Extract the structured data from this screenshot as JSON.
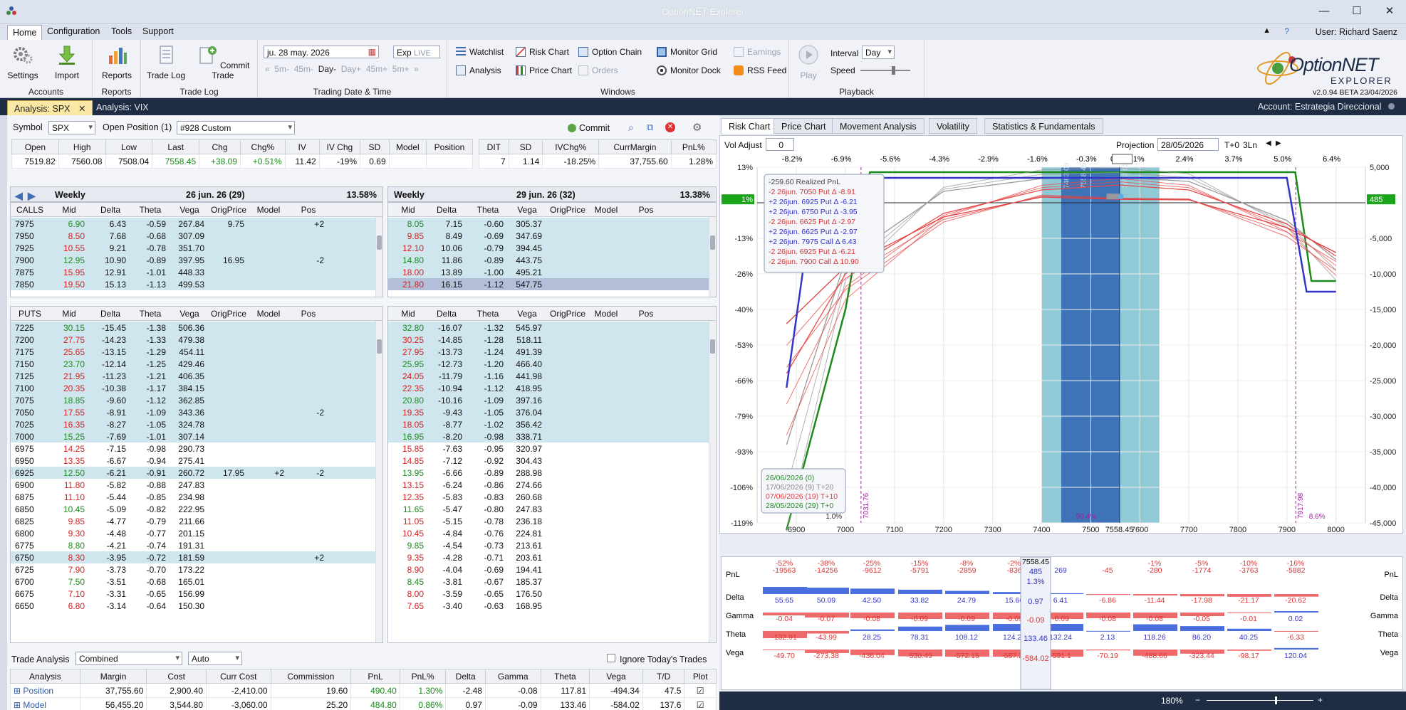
{
  "window": {
    "title": "OptionNET Explorer",
    "min": "—",
    "max": "☐",
    "close": "✕"
  },
  "menu": {
    "home": "Home",
    "configuration": "Configuration",
    "tools": "Tools",
    "support": "Support",
    "user": "User: Richard Saenz"
  },
  "ribbon": {
    "settings": "Settings",
    "import": "Import",
    "accounts": "Accounts",
    "reports_btn": "Reports",
    "reports": "Reports",
    "trade_log_btn": "Trade Log",
    "commit_trade": "Commit Trade",
    "trade_log": "Trade Log",
    "date": "ju. 28 may. 2026",
    "exp": "Exp",
    "live": "LIVE",
    "nav": [
      "5m-",
      "45m-",
      "Day-",
      "Day+",
      "45m+",
      "5m+"
    ],
    "trading_date": "Trading Date & Time",
    "watchlist": "Watchlist",
    "analysis": "Analysis",
    "risk_chart": "Risk Chart",
    "price_chart": "Price Chart",
    "option_chain": "Option Chain",
    "orders": "Orders",
    "monitor_grid": "Monitor Grid",
    "monitor_dock": "Monitor Dock",
    "earnings": "Earnings",
    "rss_feed": "RSS Feed",
    "windows": "Windows",
    "play": "Play",
    "interval": "Interval",
    "interval_val": "Day",
    "speed": "Speed",
    "playback": "Playback",
    "brand1": "OptionNET",
    "brand2": "EXPLORER",
    "version": "v2.0.94 BETA 23/04/2026"
  },
  "tabs": {
    "spx": "Analysis: SPX",
    "vix": "Analysis: VIX",
    "account": "Account: Estrategia Direccional"
  },
  "symbol": {
    "label": "Symbol",
    "value": "SPX",
    "open_label": "Open Position (1)",
    "position": "#928 Custom",
    "commit": "Commit"
  },
  "quote": {
    "headers": [
      "Open",
      "High",
      "Low",
      "Last",
      "Chg",
      "Chg%",
      "IV",
      "IV Chg",
      "SD",
      "Model",
      "Position"
    ],
    "values": [
      "7519.82",
      "7560.08",
      "7508.04",
      "7558.45",
      "+38.09",
      "+0.51%",
      "11.42",
      "-19%",
      "0.69",
      "",
      ""
    ],
    "headers2": [
      "DIT",
      "SD",
      "IVChg%",
      "CurrMargin",
      "PnL%"
    ],
    "values2": [
      "7",
      "1.14",
      "-18.25%",
      "37,755.60",
      "1.28%"
    ]
  },
  "chains": {
    "left_title": "Weekly",
    "left_exp": "26 jun. 26 (29)",
    "left_iv": "13.58%",
    "right_title": "Weekly",
    "right_exp": "29 jun. 26 (32)",
    "right_iv": "13.38%",
    "calls": "CALLS",
    "puts": "PUTS",
    "cols": [
      "Mid",
      "Delta",
      "Theta",
      "Vega",
      "OrigPrice",
      "Model",
      "Pos"
    ],
    "call_rows": [
      [
        "7975",
        "6.90",
        "6.43",
        "-0.59",
        "267.84",
        "9.75",
        "",
        "+2",
        "8.05",
        "7.15",
        "-0.60",
        "305.37"
      ],
      [
        "7950",
        "8.50",
        "7.68",
        "-0.68",
        "307.09",
        "",
        "",
        "",
        "9.85",
        "8.49",
        "-0.69",
        "347.69"
      ],
      [
        "7925",
        "10.55",
        "9.21",
        "-0.78",
        "351.70",
        "",
        "",
        "",
        "12.10",
        "10.06",
        "-0.79",
        "394.45"
      ],
      [
        "7900",
        "12.95",
        "10.90",
        "-0.89",
        "397.95",
        "16.95",
        "",
        "-2",
        "14.80",
        "11.86",
        "-0.89",
        "443.75"
      ],
      [
        "7875",
        "15.95",
        "12.91",
        "-1.01",
        "448.33",
        "",
        "",
        "",
        "18.00",
        "13.89",
        "-1.00",
        "495.21"
      ],
      [
        "7850",
        "19.50",
        "15.13",
        "-1.13",
        "499.53",
        "",
        "",
        "",
        "21.80",
        "16.15",
        "-1.12",
        "547.75"
      ]
    ],
    "put_rows": [
      [
        "7225",
        "30.15",
        "-15.45",
        "-1.38",
        "506.36",
        "",
        "",
        "",
        "32.80",
        "-16.07",
        "-1.32",
        "545.97"
      ],
      [
        "7200",
        "27.75",
        "-14.23",
        "-1.33",
        "479.38",
        "",
        "",
        "",
        "30.25",
        "-14.85",
        "-1.28",
        "518.11"
      ],
      [
        "7175",
        "25.65",
        "-13.15",
        "-1.29",
        "454.11",
        "",
        "",
        "",
        "27.95",
        "-13.73",
        "-1.24",
        "491.39"
      ],
      [
        "7150",
        "23.70",
        "-12.14",
        "-1.25",
        "429.46",
        "",
        "",
        "",
        "25.95",
        "-12.73",
        "-1.20",
        "466.40"
      ],
      [
        "7125",
        "21.95",
        "-11.23",
        "-1.21",
        "406.35",
        "",
        "",
        "",
        "24.05",
        "-11.79",
        "-1.16",
        "441.98"
      ],
      [
        "7100",
        "20.35",
        "-10.38",
        "-1.17",
        "384.15",
        "",
        "",
        "",
        "22.35",
        "-10.94",
        "-1.12",
        "418.95"
      ],
      [
        "7075",
        "18.85",
        "-9.60",
        "-1.12",
        "362.85",
        "",
        "",
        "",
        "20.80",
        "-10.16",
        "-1.09",
        "397.16"
      ],
      [
        "7050",
        "17.55",
        "-8.91",
        "-1.09",
        "343.36",
        "",
        "",
        "-2",
        "19.35",
        "-9.43",
        "-1.05",
        "376.04"
      ],
      [
        "7025",
        "16.35",
        "-8.27",
        "-1.05",
        "324.78",
        "",
        "",
        "",
        "18.05",
        "-8.77",
        "-1.02",
        "356.42"
      ],
      [
        "7000",
        "15.25",
        "-7.69",
        "-1.01",
        "307.14",
        "",
        "",
        "",
        "16.95",
        "-8.20",
        "-0.98",
        "338.71"
      ],
      [
        "6975",
        "14.25",
        "-7.15",
        "-0.98",
        "290.73",
        "",
        "",
        "",
        "15.85",
        "-7.63",
        "-0.95",
        "320.97"
      ],
      [
        "6950",
        "13.35",
        "-6.67",
        "-0.94",
        "275.41",
        "",
        "",
        "",
        "14.85",
        "-7.12",
        "-0.92",
        "304.43"
      ],
      [
        "6925",
        "12.50",
        "-6.21",
        "-0.91",
        "260.72",
        "17.95",
        "+2",
        "-2",
        "13.95",
        "-6.66",
        "-0.89",
        "288.98"
      ],
      [
        "6900",
        "11.80",
        "-5.82",
        "-0.88",
        "247.83",
        "",
        "",
        "",
        "13.15",
        "-6.24",
        "-0.86",
        "274.66"
      ],
      [
        "6875",
        "11.10",
        "-5.44",
        "-0.85",
        "234.98",
        "",
        "",
        "",
        "12.35",
        "-5.83",
        "-0.83",
        "260.68"
      ],
      [
        "6850",
        "10.45",
        "-5.09",
        "-0.82",
        "222.95",
        "",
        "",
        "",
        "11.65",
        "-5.47",
        "-0.80",
        "247.83"
      ],
      [
        "6825",
        "9.85",
        "-4.77",
        "-0.79",
        "211.66",
        "",
        "",
        "",
        "11.05",
        "-5.15",
        "-0.78",
        "236.18"
      ],
      [
        "6800",
        "9.30",
        "-4.48",
        "-0.77",
        "201.15",
        "",
        "",
        "",
        "10.45",
        "-4.84",
        "-0.76",
        "224.81"
      ],
      [
        "6775",
        "8.80",
        "-4.21",
        "-0.74",
        "191.31",
        "",
        "",
        "",
        "9.85",
        "-4.54",
        "-0.73",
        "213.61"
      ],
      [
        "6750",
        "8.30",
        "-3.95",
        "-0.72",
        "181.59",
        "",
        "",
        "+2",
        "9.35",
        "-4.28",
        "-0.71",
        "203.61"
      ],
      [
        "6725",
        "7.90",
        "-3.73",
        "-0.70",
        "173.22",
        "",
        "",
        "",
        "8.90",
        "-4.04",
        "-0.69",
        "194.41"
      ],
      [
        "6700",
        "7.50",
        "-3.51",
        "-0.68",
        "165.01",
        "",
        "",
        "",
        "8.45",
        "-3.81",
        "-0.67",
        "185.37"
      ],
      [
        "6675",
        "7.10",
        "-3.31",
        "-0.65",
        "156.99",
        "",
        "",
        "",
        "8.00",
        "-3.59",
        "-0.65",
        "176.50"
      ],
      [
        "6650",
        "6.80",
        "-3.14",
        "-0.64",
        "150.30",
        "",
        "",
        "",
        "7.65",
        "-3.40",
        "-0.63",
        "168.95"
      ]
    ]
  },
  "trade_analysis": {
    "label": "Trade Analysis",
    "mode": "Combined",
    "auto": "Auto",
    "ignore": "Ignore Today's Trades",
    "headers": [
      "Analysis",
      "Margin",
      "Cost",
      "Curr Cost",
      "Commission",
      "PnL",
      "PnL%",
      "Delta",
      "Gamma",
      "Theta",
      "Vega",
      "T/D",
      "Plot"
    ],
    "rows": [
      [
        "Position",
        "37,755.60",
        "2,900.40",
        "-2,410.00",
        "19.60",
        "490.40",
        "1.30%",
        "-2.48",
        "-0.08",
        "117.81",
        "-494.34",
        "47.5"
      ],
      [
        "Model",
        "56,455.20",
        "3,544.80",
        "-3,060.00",
        "25.20",
        "484.80",
        "0.86%",
        "0.97",
        "-0.09",
        "133.46",
        "-584.02",
        "137.6"
      ]
    ]
  },
  "right": {
    "tabs": [
      "Risk Chart",
      "Price Chart",
      "Movement Analysis",
      "Volatility",
      "Statistics & Fundamentals"
    ],
    "vol_adjust": "Vol Adjust",
    "vol_val": "0",
    "projection": "Projection",
    "proj_date": "28/05/2026",
    "proj_t": "T+0",
    "proj_ln": "3Ln",
    "zoom": "180%"
  },
  "chart_data": {
    "type": "line",
    "title": "",
    "x_ticks": [
      "6900",
      "7000",
      "7100",
      "7200",
      "7300",
      "7400",
      "7500",
      "7558.45",
      "7600",
      "7700",
      "7800",
      "7900",
      "8000"
    ],
    "top_pct": [
      "-8.2%",
      "-6.9%",
      "-5.6%",
      "-4.3%",
      "-2.9%",
      "-1.6%",
      "-0.3%",
      "0.5%",
      "1.1%",
      "2.4%",
      "3.7%",
      "5.0%",
      "6.4%"
    ],
    "y_left": [
      "13%",
      "1%",
      "-13%",
      "-26%",
      "-40%",
      "-53%",
      "-66%",
      "-79%",
      "-93%",
      "-106%",
      "-119%"
    ],
    "y_right": [
      "5,000",
      "485",
      "-5,000",
      "-10,000",
      "-15,000",
      "-20,000",
      "-25,000",
      "-30,000",
      "-35,000",
      "-40,000",
      "-45,000"
    ],
    "vlines": [
      "7031.76",
      "7917.98"
    ],
    "std_labels": [
      "1.0%",
      "90.4%",
      "8.6%"
    ],
    "legend": [
      "-259.60 Realized PnL",
      "-2 26jun. 7050 Put Δ -8.91",
      "+2 26jun. 6925 Put Δ -6.21",
      "+2 26jun. 6750 Put Δ -3.95",
      "-2 26jun. 6625 Put Δ -2.97",
      "+2 26jun. 6625 Put Δ -2.97",
      "+2 26jun. 7975 Call Δ 6.43",
      "-2 26jun. 6925 Put Δ -6.21",
      "-2 26jun. 7900 Call Δ 10.90"
    ],
    "dates": [
      "26/06/2026 (0)",
      "17/06/2026 (9) T+20",
      "07/06/2026 (19) T+10",
      "28/05/2026 (29) T+0"
    ],
    "band_labels": [
      "7463.09",
      "7558.45",
      "7653.82"
    ],
    "series": [
      {
        "name": "26/06/2026 (0)",
        "color": "#1a8a1a",
        "x": [
          6880,
          7000,
          7050,
          7060,
          7900,
          7917,
          7950,
          8000
        ],
        "y": [
          -46000,
          -15000,
          4300,
          4300,
          4300,
          4300,
          -11000,
          -11000
        ]
      },
      {
        "name": "17/06/2026 (9) T+20",
        "color": "#9a9a9a",
        "x": [
          6880,
          7000,
          7200,
          7400,
          7558,
          7700,
          7900,
          8000
        ],
        "y": [
          -34000,
          -8000,
          1600,
          3400,
          3600,
          3000,
          -2500,
          -8000
        ]
      },
      {
        "name": "07/06/2026 (19) T+10",
        "color": "#e84b4b",
        "x": [
          6880,
          7000,
          7200,
          7400,
          7558,
          7700,
          7900,
          8000
        ],
        "y": [
          -24000,
          -10000,
          -1500,
          1800,
          2500,
          1800,
          -3000,
          -7500
        ]
      },
      {
        "name": "28/05/2026 (29) T+0",
        "color": "#e24141",
        "x": [
          6880,
          7000,
          7200,
          7400,
          7558,
          7700,
          7900,
          8000
        ],
        "y": [
          -17000,
          -9000,
          -2000,
          800,
          485,
          400,
          -3500,
          -7000
        ]
      }
    ],
    "pnl_label": "485",
    "pnl_label_pct": "1%"
  },
  "greeks": {
    "rows": [
      "PnL",
      "Delta",
      "Gamma",
      "Theta",
      "Vega"
    ],
    "pnl_pct": [
      "-52%",
      "-38%",
      "-25%",
      "-15%",
      "-8%",
      "-2%",
      "",
      "",
      "-1%",
      "-5%",
      "-10%",
      "-16%"
    ],
    "pnl_val": [
      "-19563",
      "-14256",
      "-9612",
      "-5791",
      "-2859",
      "-836",
      "269",
      "-45",
      "-280",
      "-1774",
      "-3763",
      "-5882"
    ],
    "delta": [
      "55.65",
      "50.09",
      "42.50",
      "33.82",
      "24.79",
      "15.66",
      "6.41",
      "-6.86",
      "-11.44",
      "-17.98",
      "-21.17",
      "-20.62"
    ],
    "gamma": [
      "-0.04",
      "-0.07",
      "-0.08",
      "-0.09",
      "-0.09",
      "-0.09",
      "-0.09",
      "-0.08",
      "-0.08",
      "-0.05",
      "-0.01",
      "0.02"
    ],
    "theta": [
      "-132.91",
      "-43.99",
      "28.25",
      "78.31",
      "108.12",
      "124.20",
      "132.24",
      "2.13",
      "118.26",
      "86.20",
      "40.25",
      "-6.33"
    ],
    "vega": [
      "-49.70",
      "-273.38",
      "-436.04",
      "-530.49",
      "-572.15",
      "-587.28",
      "-591.1",
      "-70.19",
      "-488.66",
      "-323.44",
      "-98.17",
      "120.04"
    ],
    "center": {
      "pnl": "485",
      "pnl_pct": "1.3%",
      "delta": "0.97",
      "gamma": "-0.09",
      "theta": "133.46",
      "vega": "-584.02",
      "price": "7558.45"
    }
  }
}
